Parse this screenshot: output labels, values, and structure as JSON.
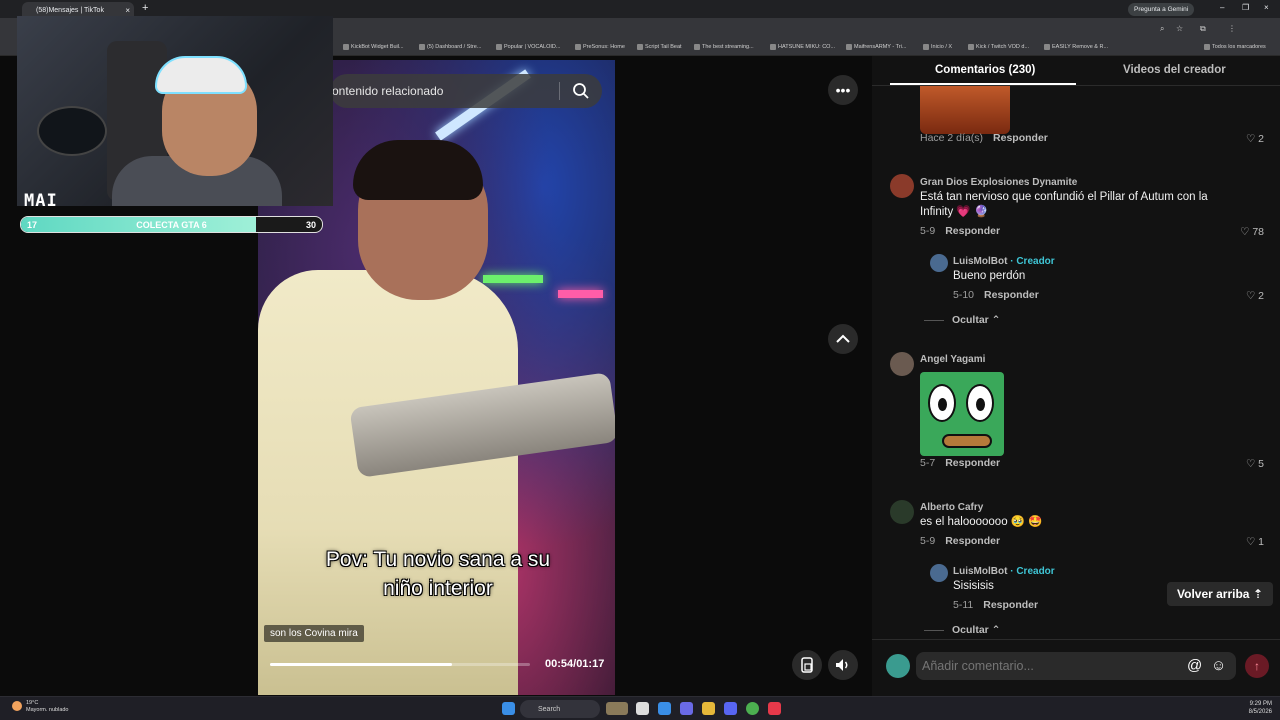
{
  "browser": {
    "tab_title": "(58)Mensajes | TikTok",
    "gemini_label": "Pregunta a Gemini",
    "all_bookmarks": "Todos los marcadores",
    "bookmarks": [
      "KickBot Widget Buil...",
      "(5) Dashboard / Stre...",
      "Popular | VOCALOID...",
      "PreSonus: Home",
      "Script Tail Beat",
      "The best streaming...",
      "HATSUNE MIKU: CO...",
      "MaifrensARMY - Tri...",
      "Inicio / X",
      "Kick / Twitch VOD d...",
      "EASILY Remove & R..."
    ]
  },
  "stream_overlay": {
    "name": "MAI",
    "goal_left": "17",
    "goal_label": "COLECTA GTA 6",
    "goal_right": "30",
    "goal_progress": 0.78
  },
  "video": {
    "search_placeholder": "ontenido relacionado",
    "caption_line1": "Pov: Tu novio sana a su",
    "caption_line2": "niño interior",
    "sub_tag": "son los Covina mira",
    "time": "00:54/01:17",
    "progress": 0.7
  },
  "sidebar": {
    "tab_comments": "Comentarios (230)",
    "tab_creator_videos": "Videos del creador",
    "reply_label": "Responder",
    "hide_label": "Ocultar",
    "creator_label": "· Creador",
    "back_to_top": "Volver arriba",
    "add_comment_placeholder": "Añadir comentario...",
    "comments": [
      {
        "meta": "Hace 2 día(s)",
        "likes": "2"
      },
      {
        "author": "Gran Dios Explosiones Dynamite",
        "text": "Está tan nervioso que confundió el Pillar of Autum con la Infinity 💗 🔮",
        "meta": "5-9",
        "likes": "78"
      },
      {
        "author": "LuisMolBot",
        "text": "Bueno perdón",
        "meta": "5-10",
        "likes": "2"
      },
      {
        "author": "Angel Yagami",
        "meta": "5-7",
        "likes": "5"
      },
      {
        "author": "Alberto Cafry",
        "text": "es el halooooooo 🥹 🤩",
        "meta": "5-9",
        "likes": "1"
      },
      {
        "author": "LuisMolBot",
        "text": "Sisisisis",
        "meta": "5-11"
      }
    ]
  },
  "taskbar": {
    "temp": "19°C",
    "weather": "Mayorm. nublado",
    "search": "Search",
    "time": "9:29 PM",
    "date": "8/5/2026"
  }
}
